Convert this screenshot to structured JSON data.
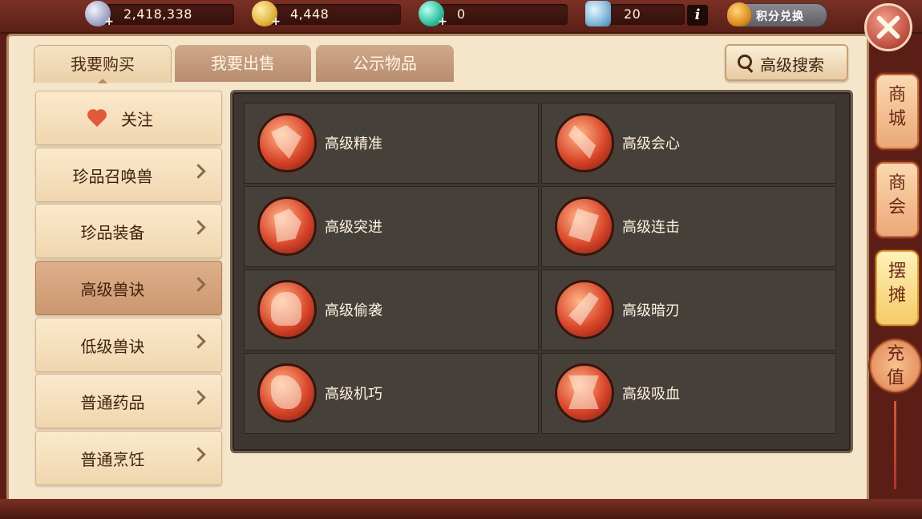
{
  "currency": {
    "silver": "2,418,338",
    "gold": "4,448",
    "gem": "0",
    "ticket": "20",
    "info_label": "i",
    "points_exchange": "积分兑换",
    "plus": "+"
  },
  "tabs": [
    {
      "label": "我要购买",
      "active": true
    },
    {
      "label": "我要出售",
      "active": false
    },
    {
      "label": "公示物品",
      "active": false
    }
  ],
  "search": {
    "label": "高级搜索"
  },
  "sidebar": {
    "favorite": "关注",
    "items": [
      {
        "label": "珍品召唤兽",
        "selected": false
      },
      {
        "label": "珍品装备",
        "selected": false
      },
      {
        "label": "高级兽诀",
        "selected": true
      },
      {
        "label": "低级兽诀",
        "selected": false
      },
      {
        "label": "普通药品",
        "selected": false
      },
      {
        "label": "普通烹饪",
        "selected": false
      }
    ]
  },
  "grid": {
    "items": [
      {
        "name": "高级精准",
        "icon": "arrow-strike-icon"
      },
      {
        "name": "高级会心",
        "icon": "sword-crit-icon"
      },
      {
        "name": "高级突进",
        "icon": "beast-charge-icon"
      },
      {
        "name": "高级连击",
        "icon": "combo-strike-icon"
      },
      {
        "name": "高级偷袭",
        "icon": "sneak-attack-icon"
      },
      {
        "name": "高级暗刃",
        "icon": "dark-blade-icon"
      },
      {
        "name": "高级机巧",
        "icon": "fist-icon"
      },
      {
        "name": "高级吸血",
        "icon": "fang-maw-icon"
      }
    ]
  },
  "right_nav": [
    {
      "label": "商城",
      "selected": false
    },
    {
      "label": "商会",
      "selected": false
    },
    {
      "label": "摆摊",
      "selected": true
    },
    {
      "label": "充值",
      "selected": false
    }
  ],
  "colors": {
    "accent": "#e25a3a",
    "panel_bg": "#f5e5cb",
    "grid_bg": "#3c3530"
  }
}
